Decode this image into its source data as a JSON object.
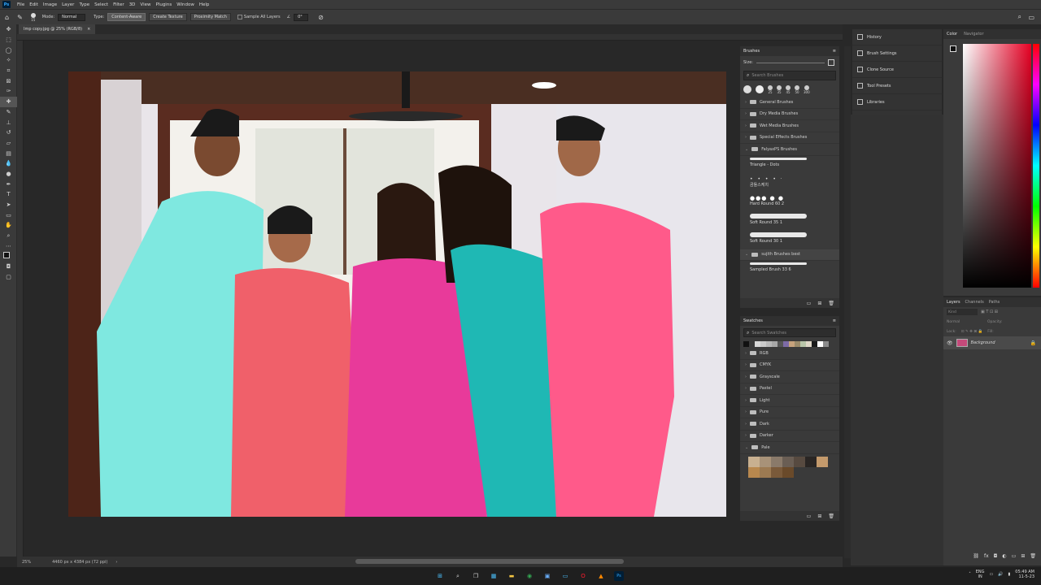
{
  "menu": {
    "logo": "Ps",
    "items": [
      "File",
      "Edit",
      "Image",
      "Layer",
      "Type",
      "Select",
      "Filter",
      "3D",
      "View",
      "Plugins",
      "Window",
      "Help"
    ]
  },
  "options": {
    "brush_size": "15",
    "mode_label": "Mode:",
    "mode_value": "Normal",
    "type_label": "Type:",
    "type_buttons": [
      "Content-Aware",
      "Create Texture",
      "Proximity Match"
    ],
    "sample_all_layers": "Sample All Layers",
    "angle_value": "0°"
  },
  "document": {
    "tab_title": "Imp copy.jpg @ 25% (RGB/8)",
    "zoom": "25%",
    "doc_info": "4460 px x 4384 px (72 ppi)"
  },
  "dock": {
    "items": [
      "History",
      "Brush Settings",
      "Clone Source",
      "Tool Presets",
      "Libraries"
    ]
  },
  "brushes": {
    "title": "Brushes",
    "size_label": "Size:",
    "search_placeholder": "Search Brushes",
    "preset_sizes": [
      "25",
      "35",
      "45",
      "50",
      "300"
    ],
    "groups": [
      "General Brushes",
      "Dry Media Brushes",
      "Wet Media Brushes",
      "Special Effects Brushes",
      "FalyaxPS Brushes"
    ],
    "brush_items": [
      "Triangle - Dots",
      "곰돌스케치",
      "Hard Round 60 2",
      "Soft Round 35 1",
      "Soft Round 30 1"
    ],
    "group2": "sujith Brushes best",
    "brush_item_last": "Sampled Brush 33 6"
  },
  "swatches": {
    "title": "Swatches",
    "search_placeholder": "Search Swatches",
    "recent_colors": [
      "#111111",
      "#3a3a3a",
      "#d8d8d8",
      "#c9c9c9",
      "#b8b8b8",
      "#a8a8a8",
      "#555555",
      "#7d6ba6",
      "#c6a27c",
      "#9a8a6a",
      "#b9c6a9",
      "#e0d8c8",
      "#1a1a1a",
      "#ffffff",
      "#8a8a8a"
    ],
    "groups": [
      "RGB",
      "CMYK",
      "Grayscale",
      "Pastel",
      "Light",
      "Pure",
      "Dark",
      "Darker",
      "Pale"
    ],
    "pale_colors": [
      "#c8b090",
      "#a89278",
      "#8a7a6a",
      "#6a5e54",
      "#574a40",
      "#2a2624",
      "#c49a6c",
      "#b8884e",
      "#9c7a52",
      "#7a5a3a",
      "#6a4a2a"
    ]
  },
  "color_panel": {
    "tabs": [
      "Color",
      "Navigator"
    ]
  },
  "layers": {
    "tabs": [
      "Layers",
      "Channels",
      "Paths"
    ],
    "kind_placeholder": "Kind",
    "blend_mode": "Normal",
    "opacity_label": "Opacity:",
    "lock_label": "Lock:",
    "fill_label": "Fill:",
    "layer_name": "Background"
  },
  "taskbar": {
    "lang_top": "ENG",
    "lang_bottom": "IN",
    "time": "05:49 AM",
    "date": "11-5-23"
  }
}
